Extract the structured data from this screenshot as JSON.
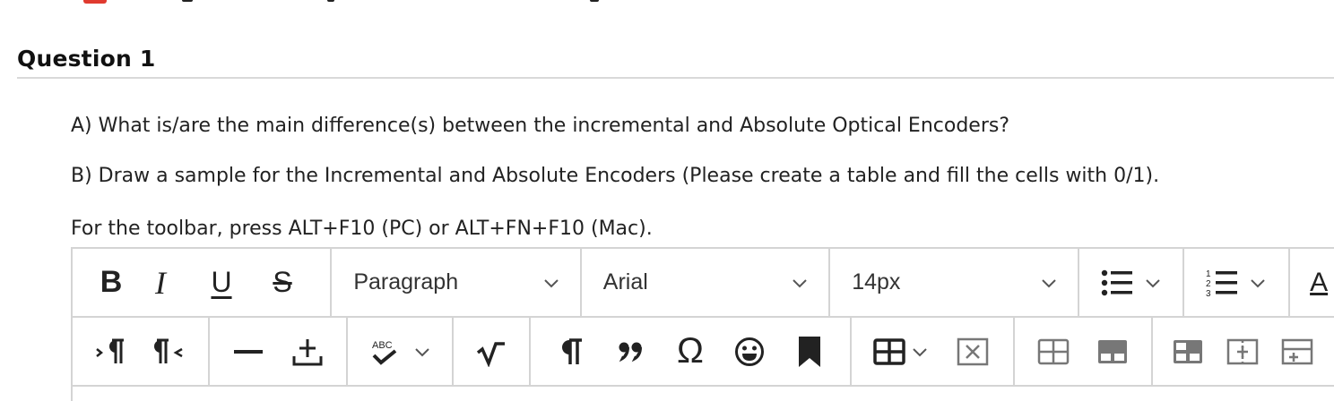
{
  "question": {
    "title": "Question 1",
    "lines": [
      "A) What is/are the main difference(s) between the incremental and Absolute Optical Encoders?",
      "B) Draw a sample for the Incremental and Absolute Encoders (Please create a table and fill the cells with 0/1).",
      "For the toolbar, press ALT+F10 (PC) or ALT+FN+F10 (Mac)."
    ]
  },
  "toolbar": {
    "bold": "B",
    "italic": "I",
    "underline": "U",
    "strike": "S",
    "paragraph_select": "Paragraph",
    "font_select": "Arial",
    "size_select": "14px",
    "spellcheck_label": "ABC",
    "text_color_label": "A"
  },
  "colors": {
    "accent_red": "#e03a2f",
    "border": "#d4d4d4"
  },
  "icons": {
    "row1": [
      "bold",
      "italic",
      "underline",
      "strikethrough",
      "bullet-list",
      "numbered-list",
      "text-color"
    ],
    "row2": [
      "ltr",
      "rtl",
      "horizontal-rule",
      "insert-content",
      "spellcheck",
      "math",
      "paragraph-mark",
      "blockquote",
      "special-char",
      "emoji",
      "bookmark",
      "table",
      "table-delete",
      "table-cell",
      "table-row",
      "table-split",
      "table-insert-row",
      "table-insert-col"
    ]
  }
}
